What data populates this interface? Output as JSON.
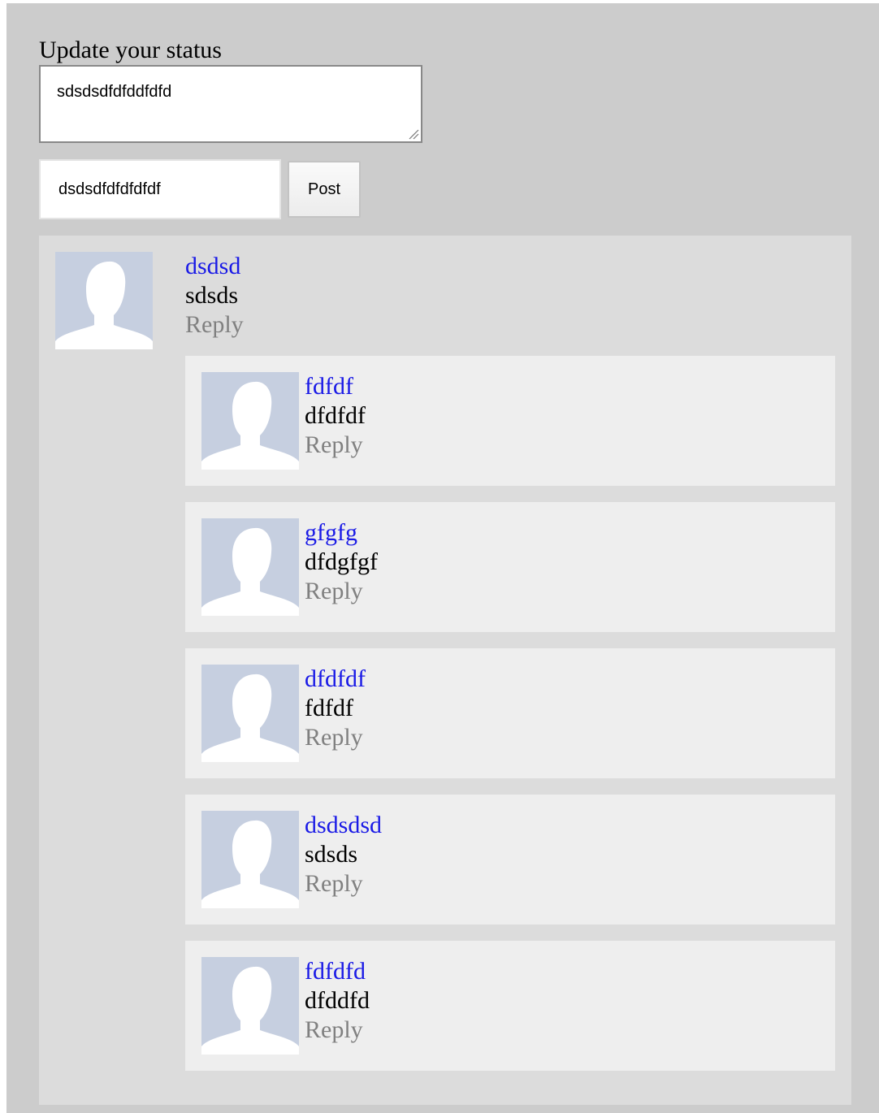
{
  "status_form": {
    "label": "Update your status",
    "status_value": "sdsdsdfdfddfdfd",
    "name_value": "dsdsdfdfdfdfdf",
    "post_label": "Post"
  },
  "post": {
    "author": "dsdsd",
    "text": "sdsds",
    "reply_label": "Reply",
    "replies": [
      {
        "author": "fdfdf",
        "text": "dfdfdf",
        "reply_label": "Reply"
      },
      {
        "author": "gfgfg",
        "text": "dfdgfgf",
        "reply_label": "Reply"
      },
      {
        "author": "dfdfdf",
        "text": "fdfdf",
        "reply_label": "Reply"
      },
      {
        "author": "dsdsdsd",
        "text": "sdsds",
        "reply_label": "Reply"
      },
      {
        "author": "fdfdfd",
        "text": "dfddfd",
        "reply_label": "Reply"
      }
    ]
  },
  "colors": {
    "page_bg": "#cccccc",
    "card_bg": "#dcdcdc",
    "reply_bg": "#eeeeee",
    "author_link": "#1a1ae6",
    "reply_link": "#808080",
    "avatar_bg": "#c6cfe0"
  },
  "icons": {
    "avatar": "default-profile-silhouette-icon",
    "resize": "resize-grip-icon"
  }
}
